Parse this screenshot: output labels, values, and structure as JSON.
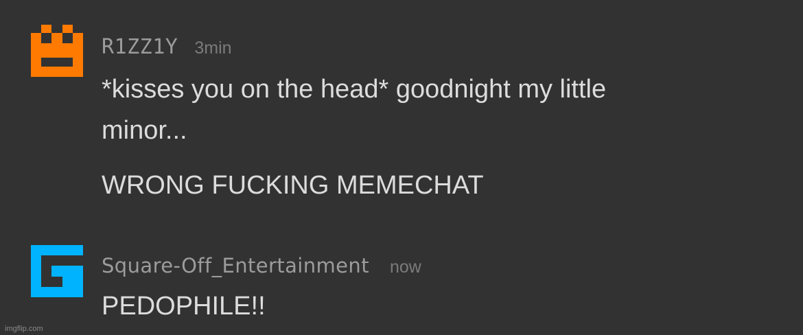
{
  "messages": [
    {
      "user": "R1ZZ1Y",
      "time": "3min",
      "avatar_icon": "orange-pixel-face-icon",
      "avatar_color": "#ff7a00",
      "lines": [
        "*kisses you on the head* goodnight my little\nminor...",
        "WRONG FUCKING MEMECHAT"
      ]
    },
    {
      "user": "Square-Off_Entertainment",
      "time": "now",
      "avatar_icon": "blue-pixel-g-icon",
      "avatar_color": "#00b3ff",
      "lines": [
        "PEDOPHILE!!"
      ]
    }
  ],
  "watermark": "imgflip.com",
  "colors": {
    "background": "#323232",
    "username": "#9c9c9c",
    "timestamp": "#7b7b7b",
    "message_text": "#dcdcdc"
  }
}
